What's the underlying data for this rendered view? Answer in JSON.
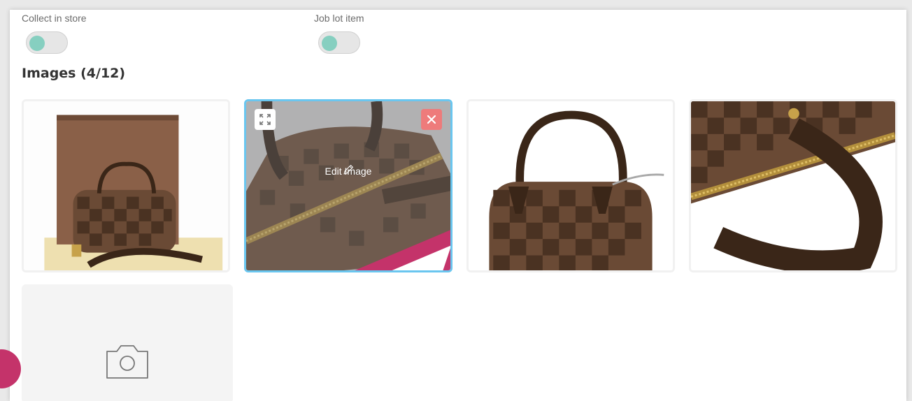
{
  "toggles": {
    "collect_in_store": {
      "label": "Collect in store",
      "on": false
    },
    "job_lot_item": {
      "label": "Job lot item",
      "on": false
    }
  },
  "images_section": {
    "title": "Images (4/12)",
    "count": 4,
    "max": 12
  },
  "images": [
    {
      "subject": "bag-with-box"
    },
    {
      "subject": "bag-handle-closeup",
      "selected": true,
      "edit_label": "Edit Image"
    },
    {
      "subject": "bag-front"
    },
    {
      "subject": "bag-handle-detail"
    }
  ],
  "icons": {
    "expand": "expand-icon",
    "remove": "close-icon",
    "edit": "pencil-icon",
    "add_photo": "camera-icon",
    "pointer": "pointer-cursor-icon"
  },
  "colors": {
    "toggle_knob": "#86cfc0",
    "selected_border": "#6ac6ef",
    "remove_button": "#ee7b7b",
    "chat_bubble": "#c4336a",
    "pointer": "#c4336a"
  }
}
